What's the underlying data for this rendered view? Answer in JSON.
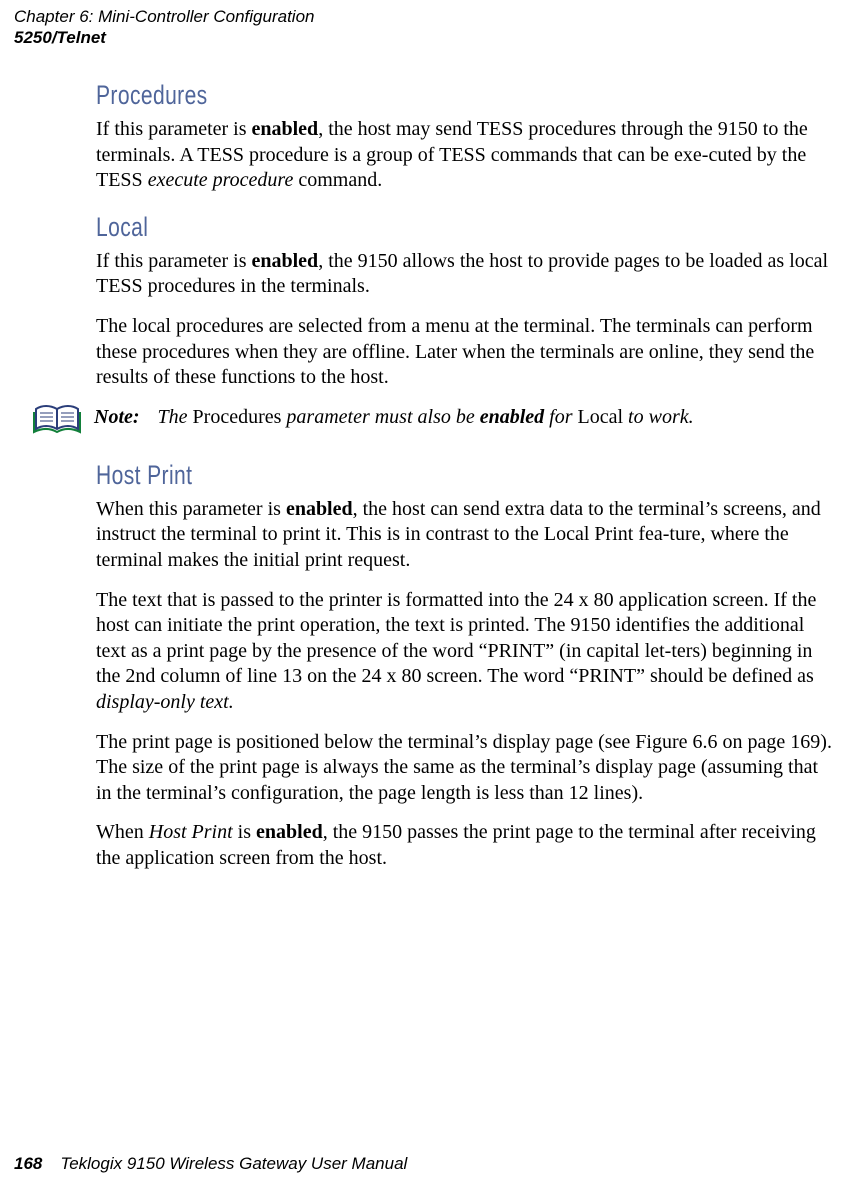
{
  "header": {
    "line1": "Chapter 6: Mini-Controller Configuration",
    "line2": "5250/Telnet"
  },
  "sections": {
    "procedures": {
      "heading": "Procedures",
      "p1_a": "If this parameter is ",
      "p1_b": "enabled",
      "p1_c": ", the host may send TESS procedures through the 9150 to the terminals. A TESS procedure is a group of TESS commands that can be exe-cuted by the TESS ",
      "p1_d": "execute procedure",
      "p1_e": " command."
    },
    "local": {
      "heading": "Local",
      "p1_a": "If this parameter is ",
      "p1_b": "enabled",
      "p1_c": ", the 9150 allows the host to provide pages to be loaded as local TESS procedures in the terminals.",
      "p2": "The local procedures are selected from a menu at the terminal. The terminals can perform these procedures when they are offline. Later when the terminals are online, they send the results of these functions to the host."
    },
    "note": {
      "label": "Note:",
      "a": "The ",
      "b": "Procedures",
      "c": " parameter must also be ",
      "d": "enabled",
      "e": " for ",
      "f": "Local",
      "g": " to work."
    },
    "hostprint": {
      "heading": "Host Print",
      "p1_a": "When this parameter is ",
      "p1_b": "enabled",
      "p1_c": ", the host can send extra data to the terminal’s screens, and instruct the terminal to print it. This is in contrast to the Local Print fea-ture, where the terminal makes the initial print request.",
      "p2_a": "The text that is passed to the printer is formatted into the 24 x 80 application screen. If the host can initiate the print operation, the text is printed. The 9150 identifies the additional text as a print page by the presence of the word “PRINT” (in capital let-ters) beginning in the 2nd column of line 13 on the 24 x 80 screen. The word “PRINT” should be defined as ",
      "p2_b": "display-only text.",
      "p3": "The print page is positioned below the terminal’s display page (see Figure 6.6 on page 169). The size of the print page is always the same as the terminal’s display page (assuming that in the terminal’s configuration, the page length is less than 12 lines).",
      "p4_a": "When ",
      "p4_b": "Host Print",
      "p4_c": " is ",
      "p4_d": "enabled",
      "p4_e": ", the 9150 passes the print page to the terminal after receiving the application screen from the host."
    }
  },
  "footer": {
    "pageno": "168",
    "title": "Teklogix 9150 Wireless Gateway User Manual"
  }
}
